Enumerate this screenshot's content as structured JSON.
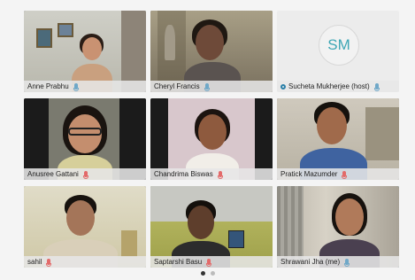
{
  "participants": [
    {
      "name": "Anne Prabhu",
      "mic": "on"
    },
    {
      "name": "Cheryl Francis",
      "mic": "on"
    },
    {
      "name": "Sucheta Mukherjee (host)",
      "mic": "on",
      "initials": "SM",
      "video": "off"
    },
    {
      "name": "Anusree Gattani",
      "mic": "off"
    },
    {
      "name": "Chandrima Biswas",
      "mic": "off"
    },
    {
      "name": "Pratick Mazumder",
      "mic": "off"
    },
    {
      "name": "sahil",
      "mic": "off"
    },
    {
      "name": "Saptarshi Basu",
      "mic": "off"
    },
    {
      "name": "Shrawani  Jha (me)",
      "mic": "on",
      "active": true
    }
  ],
  "pagination": {
    "pages": 2,
    "current": 1
  },
  "colors": {
    "accent": "#3aa0c9",
    "mic_on": "#6fa8c8",
    "mic_off": "#e36a6a",
    "initials": "#3fa7b5"
  }
}
